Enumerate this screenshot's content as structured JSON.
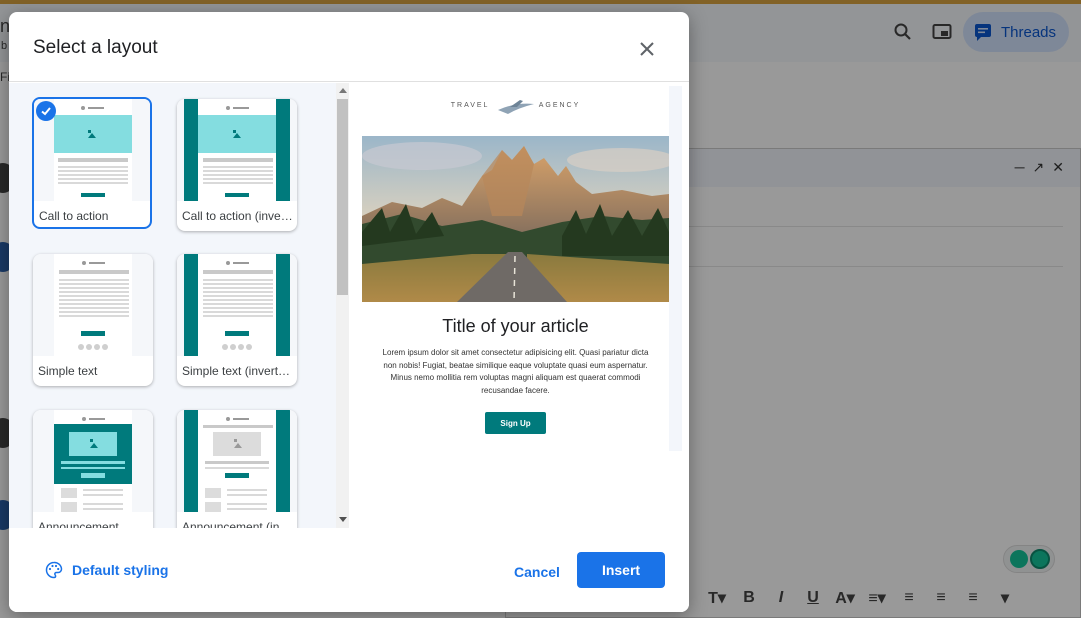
{
  "background": {
    "threads_label": "Threads",
    "partial_text_1": "nt",
    "partial_text_2": "b",
    "partial_text_3": "Fi"
  },
  "dialog": {
    "title": "Select a layout",
    "layouts": [
      {
        "label": "Call to action",
        "selected": true
      },
      {
        "label": "Call to action (inverted)",
        "selected": false
      },
      {
        "label": "Simple text",
        "selected": false
      },
      {
        "label": "Simple text (inverted)",
        "selected": false
      },
      {
        "label": "Announcement",
        "selected": false
      },
      {
        "label": "Announcement (inverted)",
        "selected": false
      }
    ],
    "preview": {
      "brand_left": "TRAVEL",
      "brand_right": "AGENCY",
      "article_title": "Title of your article",
      "article_body": "Lorem ipsum dolor sit amet consectetur adipisicing elit. Quasi pariatur dicta non nobis! Fugiat, beatae similique eaque voluptate quasi eum aspernatur. Minus nemo mollitia rem voluptas magni aliquam est quaerat commodi recusandae facere.",
      "button_label": "Sign Up"
    },
    "footer": {
      "default_styling_label": "Default styling",
      "cancel_label": "Cancel",
      "insert_label": "Insert"
    }
  },
  "colors": {
    "accent": "#1a73e8",
    "teal": "#007a7c",
    "image_placeholder": "#84dde0"
  }
}
